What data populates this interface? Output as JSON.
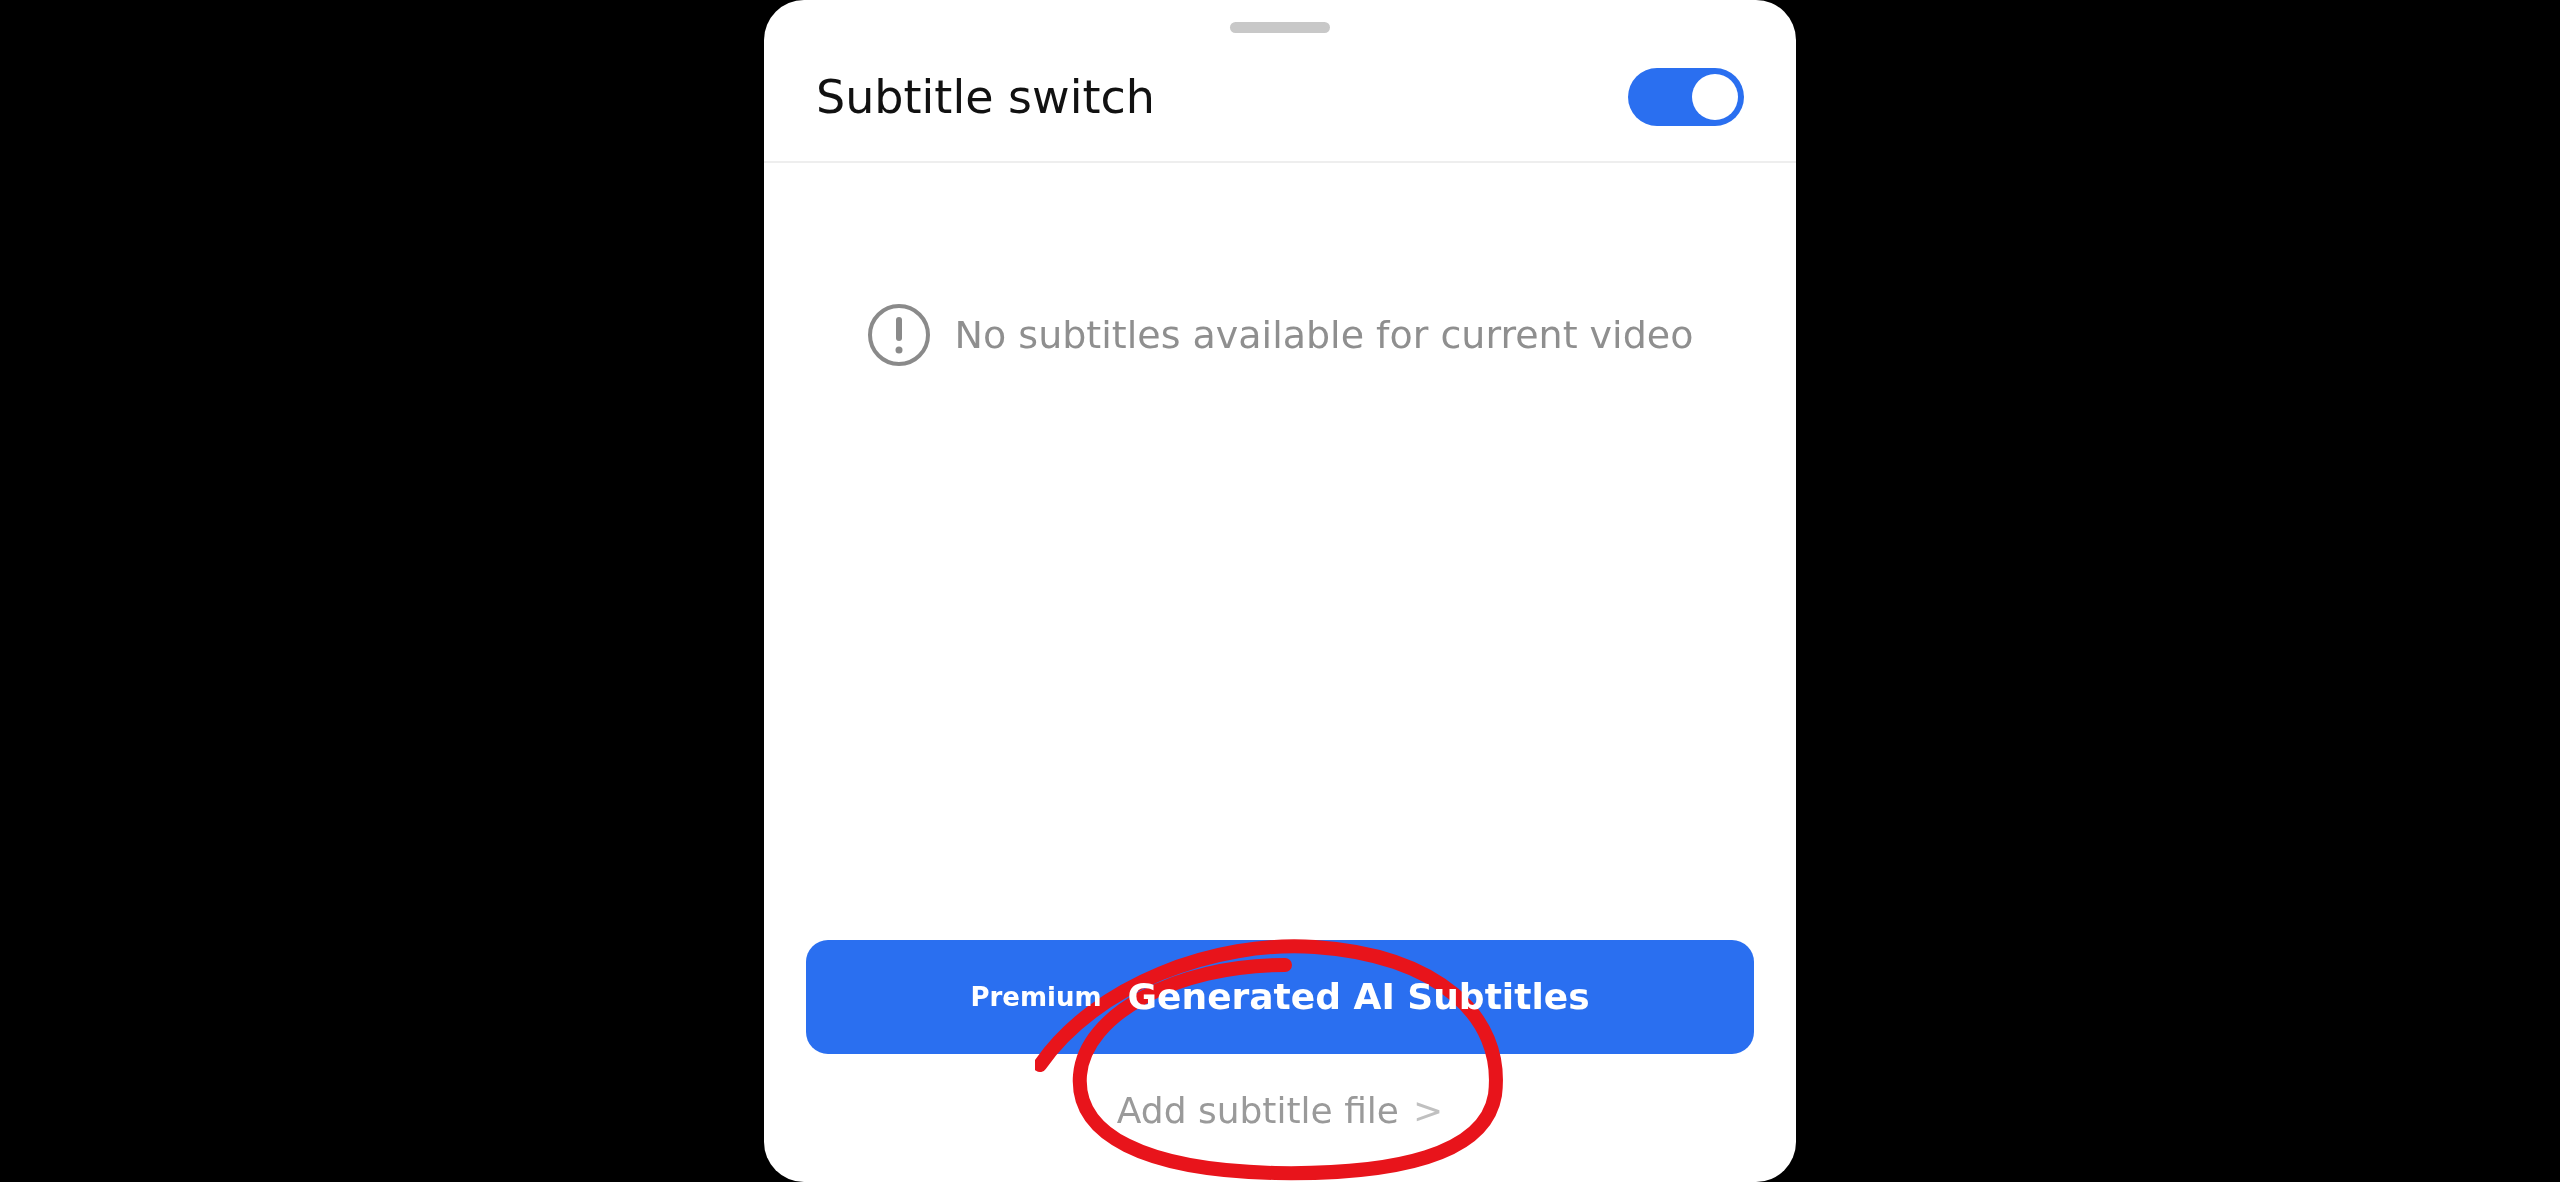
{
  "panel": {
    "title": "Subtitle switch",
    "switch_on": true
  },
  "message": "No subtitles available for current video",
  "ai_button": {
    "badge": "Premium",
    "label": "Generated AI Subtitles"
  },
  "add_link": {
    "label": "Add subtitle file",
    "arrow": ">"
  }
}
